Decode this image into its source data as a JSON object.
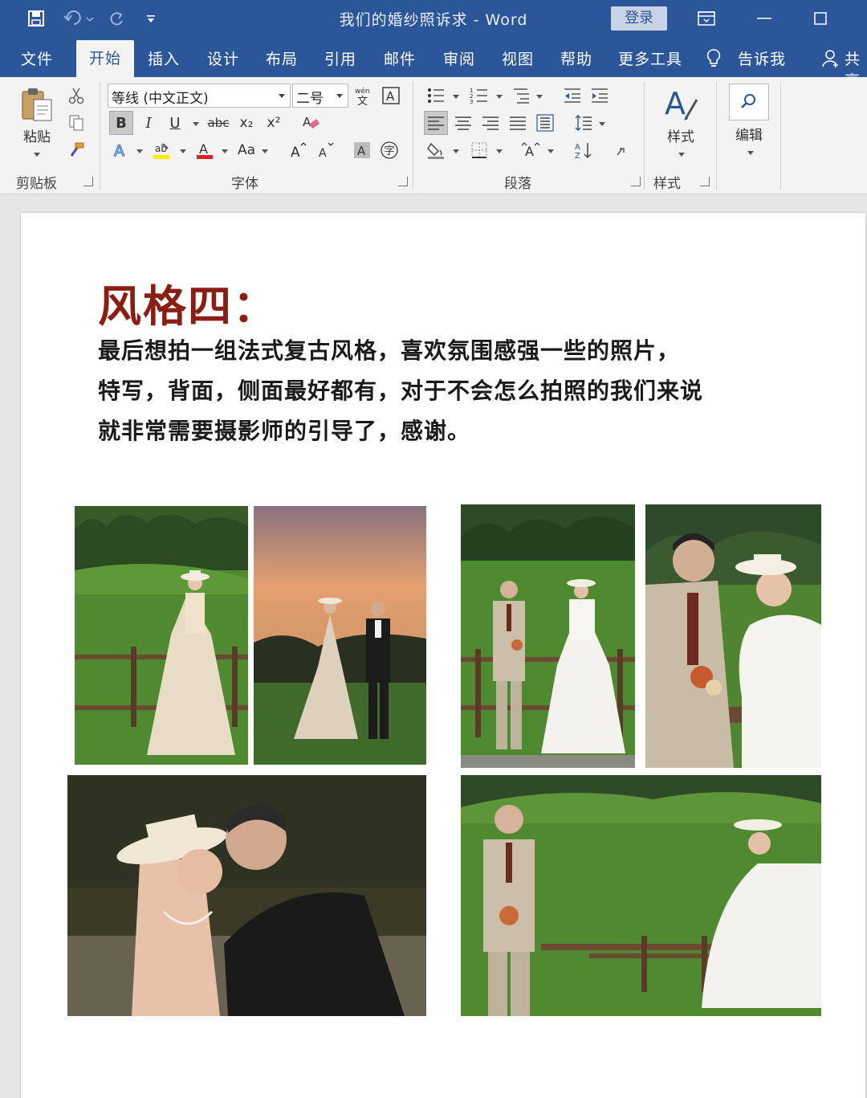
{
  "window": {
    "title": "我们的婚纱照诉求 - Word",
    "login_label": "登录"
  },
  "tabs": [
    "文件",
    "开始",
    "插入",
    "设计",
    "布局",
    "引用",
    "邮件",
    "审阅",
    "视图",
    "帮助",
    "更多工具",
    "告诉我",
    "共享"
  ],
  "active_tab": "开始",
  "ribbon": {
    "clipboard": {
      "paste_label": "粘贴",
      "group_label": "剪贴板"
    },
    "font": {
      "font_name": "等线 (中文正文)",
      "font_size": "二号",
      "bold": "B",
      "italic": "I",
      "underline": "U",
      "strike": "abc",
      "subscript": "x₂",
      "superscript": "x²",
      "change_case": "Aa",
      "group_label": "字体"
    },
    "paragraph": {
      "group_label": "段落"
    },
    "styles": {
      "label": "样式",
      "group_label": "样式"
    },
    "editing": {
      "label": "编辑"
    }
  },
  "document": {
    "heading": "风格四：",
    "paragraph_lines": [
      "最后想拍一组法式复古风格，喜欢氛围感强一些的照片，",
      "特写，背面，侧面最好都有，对于不会怎么拍照的我们来说",
      "就非常需要摄影师的引导了，感谢。"
    ]
  },
  "colors": {
    "word_blue": "#2b579a",
    "heading_red": "#8b1d12",
    "ribbon_bg": "#f3f3f3"
  }
}
